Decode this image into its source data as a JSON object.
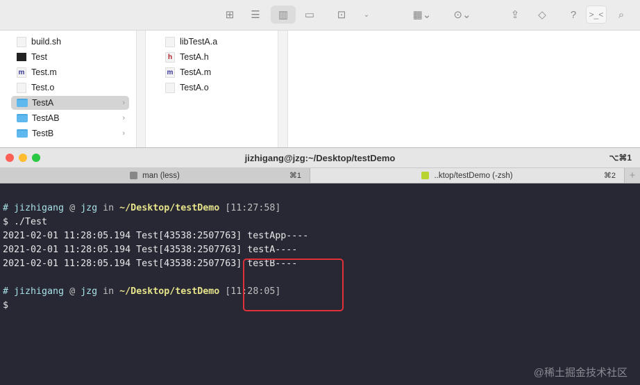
{
  "toolbar": {
    "icons": [
      "grid-view-icon",
      "list-view-icon",
      "column-view-icon",
      "gallery-view-icon",
      "terminal-action-icon",
      "chevron-down-icon",
      "group-icon",
      "more-icon",
      "share-icon",
      "tag-icon",
      "help-icon",
      "terminal-icon",
      "search-icon"
    ],
    "help": "?"
  },
  "finder": {
    "col1": [
      {
        "name": "build.sh",
        "type": "doc"
      },
      {
        "name": "Test",
        "type": "exec"
      },
      {
        "name": "Test.m",
        "type": "m"
      },
      {
        "name": "Test.o",
        "type": "doc"
      },
      {
        "name": "TestA",
        "type": "folder",
        "selected": true
      },
      {
        "name": "TestAB",
        "type": "folder"
      },
      {
        "name": "TestB",
        "type": "folder"
      }
    ],
    "col2": [
      {
        "name": "libTestA.a",
        "type": "doc"
      },
      {
        "name": "TestA.h",
        "type": "h"
      },
      {
        "name": "TestA.m",
        "type": "m"
      },
      {
        "name": "TestA.o",
        "type": "doc"
      }
    ],
    "glyph_m": "m",
    "glyph_h": "h",
    "chev": "›"
  },
  "terminal": {
    "title": "jizhigang@jzg:~/Desktop/testDemo",
    "title_shortcut": "⌥⌘1",
    "tabs": [
      {
        "label": "man (less)",
        "shortcut": "⌘1"
      },
      {
        "label": "..ktop/testDemo (-zsh)",
        "shortcut": "⌘2"
      }
    ],
    "new_tab": "+",
    "prompt1": {
      "hash": "# ",
      "user": "jizhigang",
      "at": " @ ",
      "host": "jzg",
      "in": " in ",
      "path": "~/Desktop/testDemo",
      "time": " [11:27:58]"
    },
    "cmd": "$ ./Test",
    "logs": [
      "2021-02-01 11:28:05.194 Test[43538:2507763] testApp----",
      "2021-02-01 11:28:05.194 Test[43538:2507763] testA----",
      "2021-02-01 11:28:05.194 Test[43538:2507763] testB----"
    ],
    "prompt2": {
      "hash": "# ",
      "user": "jizhigang",
      "at": " @ ",
      "host": "jzg",
      "in": " in ",
      "path": "~/Desktop/testDemo",
      "time": " [11:28:05]"
    },
    "cursor": "$"
  },
  "watermark": "@稀土掘金技术社区"
}
